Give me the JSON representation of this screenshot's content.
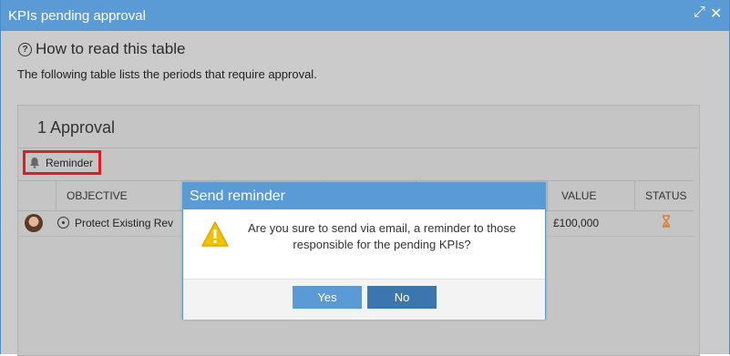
{
  "window": {
    "title": "KPIs pending approval",
    "controls": {
      "maximize_icon": "⤢",
      "close_icon": "✕"
    }
  },
  "help": {
    "icon": "?",
    "link": "How to read this table"
  },
  "description": "The following table lists the periods that require approval.",
  "panel": {
    "title": "1 Approval",
    "reminder_label": "Reminder",
    "columns": [
      "OBJECTIVE",
      "VALUE",
      "STATUS"
    ],
    "rows": [
      {
        "objective": "Protect Existing Rev",
        "value": "£100,000",
        "status_icon": "hourglass-icon"
      }
    ]
  },
  "dialog": {
    "title": "Send reminder",
    "message": "Are you sure to send via email, a reminder to those responsible for the pending KPIs?",
    "yes_label": "Yes",
    "no_label": "No"
  },
  "colors": {
    "header_blue": "#5b9bd5",
    "button_dark": "#3b76ae",
    "highlight_red": "#e31b23",
    "overlay_grey": "#cbcbcb",
    "warning_yellow": "#f2c200",
    "hourglass_orange": "#e07b22"
  }
}
